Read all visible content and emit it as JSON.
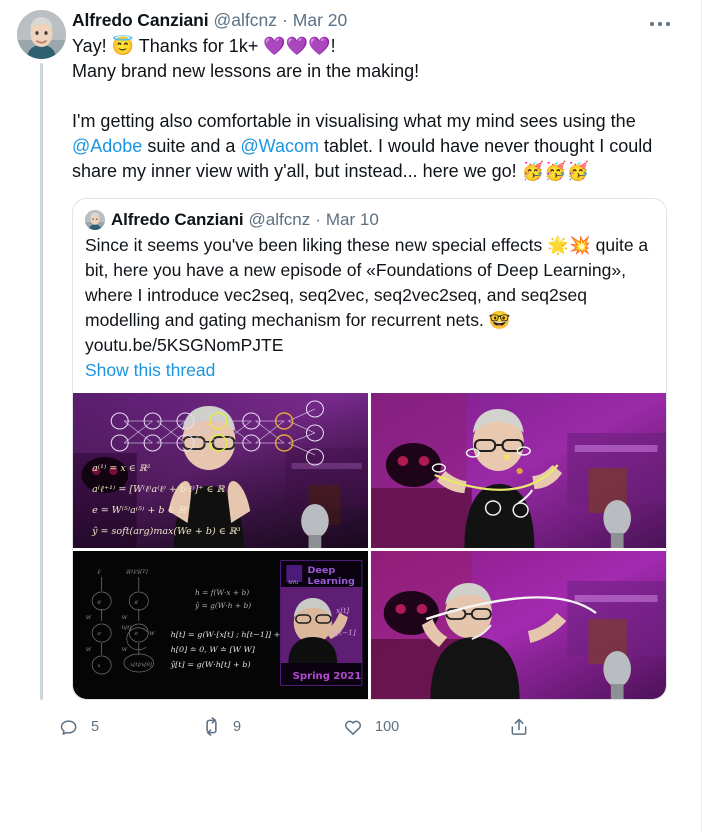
{
  "main_tweet": {
    "display_name": "Alfredo Canziani",
    "handle": "@alfcnz",
    "separator": "·",
    "date": "Mar 20",
    "line1": "Yay! 😇 Thanks for 1k+ 💜💜💜!",
    "line2": "Many brand new lessons are in the making!",
    "para2_a": "I'm getting also comfortable in visualising what my mind sees using the ",
    "mention1": "@Adobe",
    "para2_b": " suite and a ",
    "mention2": "@Wacom",
    "para2_c": " tablet. I would have never thought I could share my inner view with y'all, but instead... here we go! 🥳🥳🥳",
    "more_label": "More"
  },
  "quoted_tweet": {
    "display_name": "Alfredo Canziani",
    "handle": "@alfcnz",
    "separator": "·",
    "date": "Mar 10",
    "body": "Since it seems you've been liking these new special effects 🌟💥 quite a bit, here you have a new episode of «Foundations of Deep Learning», where I introduce vec2seq, seq2vec, seq2vec2seq, and seq2seq modelling and gating mechanism for recurrent nets. 🤓",
    "url": "youtu.be/5KSGNomPJTE",
    "show_thread": "Show this thread",
    "media": [
      {
        "name": "neural-network-overlay-video",
        "alt": "Presenter in purple-lit room with neural network diagram and equations overlaid",
        "overlay_text": [
          "a^(1) = x ∈ R²",
          "a^(ℓ+1) = [W^(ℓ) a^(ℓ) + b^(ℓ)]⁺",
          "e = W^(5) a^(5) + b ∈ R³",
          "ŷ = soft(arg)max(We + b) ∈ R³"
        ]
      },
      {
        "name": "presenter-gesturing-video",
        "alt": "Presenter gesturing with both hands, glowing curve between fingers, purple room"
      },
      {
        "name": "rnn-equations-slide",
        "alt": "Dark slide with recurrent network equations and NYU Deep Learning Spring 2021 thumbnail",
        "slide_title": "Deep Learning",
        "slide_term": "Spring 2021",
        "slide_org": "NYU"
      },
      {
        "name": "presenter-stretched-curve-video",
        "alt": "Presenter stretching a long glowing curve across frame in purple room"
      }
    ]
  },
  "actions": {
    "reply": {
      "icon": "reply-icon",
      "count": "5"
    },
    "retweet": {
      "icon": "retweet-icon",
      "count": "9"
    },
    "like": {
      "icon": "heart-icon",
      "count": "100"
    },
    "share": {
      "icon": "share-icon",
      "count": ""
    }
  },
  "colors": {
    "link": "#1b95e0",
    "text": "#0f1419",
    "muted": "#5b7083",
    "border": "#dfe3e6",
    "thread_line": "#ccd6dd"
  }
}
